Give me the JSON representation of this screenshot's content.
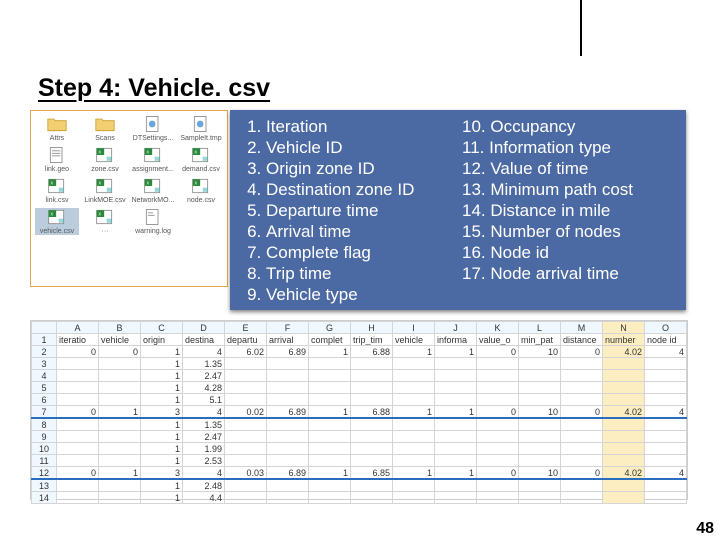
{
  "title": "Step 4: Vehicle. csv",
  "page_number": "48",
  "explorer": {
    "items": [
      {
        "type": "folder",
        "label": "Attrs"
      },
      {
        "type": "folder",
        "label": "Scans"
      },
      {
        "type": "file",
        "label": "DTSettings..."
      },
      {
        "type": "file",
        "label": "SampleIt.tmp"
      },
      {
        "type": "txt",
        "label": "link.geo"
      },
      {
        "type": "csv",
        "label": "zone.csv"
      },
      {
        "type": "csv",
        "label": "assignment..."
      },
      {
        "type": "csv",
        "label": "demand.csv"
      },
      {
        "type": "csv",
        "label": "link.csv"
      },
      {
        "type": "csv",
        "label": "LinkMOE.csv"
      },
      {
        "type": "csv",
        "label": "NetworkMO..."
      },
      {
        "type": "csv",
        "label": "node.csv"
      },
      {
        "type": "csv",
        "label": "vehicle.csv",
        "selected": true
      },
      {
        "type": "csv",
        "label": "···"
      },
      {
        "type": "ini",
        "label": "warning.log"
      }
    ]
  },
  "columns": {
    "left": [
      "Iteration",
      "Vehicle ID",
      "Origin zone ID",
      "Destination zone ID",
      "Departure time",
      "Arrival time",
      "Complete flag",
      "Trip time",
      "Vehicle type"
    ],
    "right": [
      "Occupancy",
      "Information type",
      "Value of time",
      "Minimum path cost",
      "Distance in mile",
      "Number of nodes",
      "Node id",
      "Node arrival time"
    ],
    "right_start": 10
  },
  "sheet": {
    "col_letters": [
      "",
      "A",
      "B",
      "C",
      "D",
      "E",
      "F",
      "G",
      "H",
      "I",
      "J",
      "K",
      "L",
      "M",
      "N",
      "O"
    ],
    "headers_row": [
      "1",
      "iteratio",
      "vehicle",
      "origin",
      "destina",
      "departu",
      "arrival",
      "complet",
      "trip_tim",
      "vehicle",
      "informa",
      "value_o",
      "min_pat",
      "distance",
      "number",
      "node id"
    ],
    "rows": [
      [
        "2",
        "0",
        "0",
        "1",
        "4",
        "6.02",
        "6.89",
        "1",
        "6.88",
        "1",
        "1",
        "0",
        "10",
        "0",
        "4.02",
        "4"
      ],
      [
        "3",
        "",
        "",
        "1",
        "1.35",
        "",
        "",
        "",
        "",
        "",
        "",
        "",
        "",
        "",
        "",
        ""
      ],
      [
        "4",
        "",
        "",
        "1",
        "2.47",
        "",
        "",
        "",
        "",
        "",
        "",
        "",
        "",
        "",
        "",
        ""
      ],
      [
        "5",
        "",
        "",
        "1",
        "4.28",
        "",
        "",
        "",
        "",
        "",
        "",
        "",
        "",
        "",
        "",
        ""
      ],
      [
        "6",
        "",
        "",
        "1",
        "5.1",
        "",
        "",
        "",
        "",
        "",
        "",
        "",
        "",
        "",
        "",
        ""
      ],
      [
        "7",
        "0",
        "1",
        "3",
        "4",
        "0.02",
        "6.89",
        "1",
        "6.88",
        "1",
        "1",
        "0",
        "10",
        "0",
        "4.02",
        "4"
      ],
      [
        "8",
        "",
        "",
        "1",
        "1.35",
        "",
        "",
        "",
        "",
        "",
        "",
        "",
        "",
        "",
        "",
        ""
      ],
      [
        "9",
        "",
        "",
        "1",
        "2.47",
        "",
        "",
        "",
        "",
        "",
        "",
        "",
        "",
        "",
        "",
        ""
      ],
      [
        "10",
        "",
        "",
        "1",
        "1.99",
        "",
        "",
        "",
        "",
        "",
        "",
        "",
        "",
        "",
        "",
        ""
      ],
      [
        "11",
        "",
        "",
        "1",
        "2.53",
        "",
        "",
        "",
        "",
        "",
        "",
        "",
        "",
        "",
        "",
        ""
      ],
      [
        "12",
        "0",
        "1",
        "3",
        "4",
        "0.03",
        "6.89",
        "1",
        "6.85",
        "1",
        "1",
        "0",
        "10",
        "0",
        "4.02",
        "4"
      ],
      [
        "13",
        "",
        "",
        "1",
        "2.48",
        "",
        "",
        "",
        "",
        "",
        "",
        "",
        "",
        "",
        "",
        ""
      ],
      [
        "14",
        "",
        "",
        "1",
        "4.4",
        "",
        "",
        "",
        "",
        "",
        "",
        "",
        "",
        "",
        "",
        ""
      ]
    ],
    "highlight_col_index": 14
  }
}
